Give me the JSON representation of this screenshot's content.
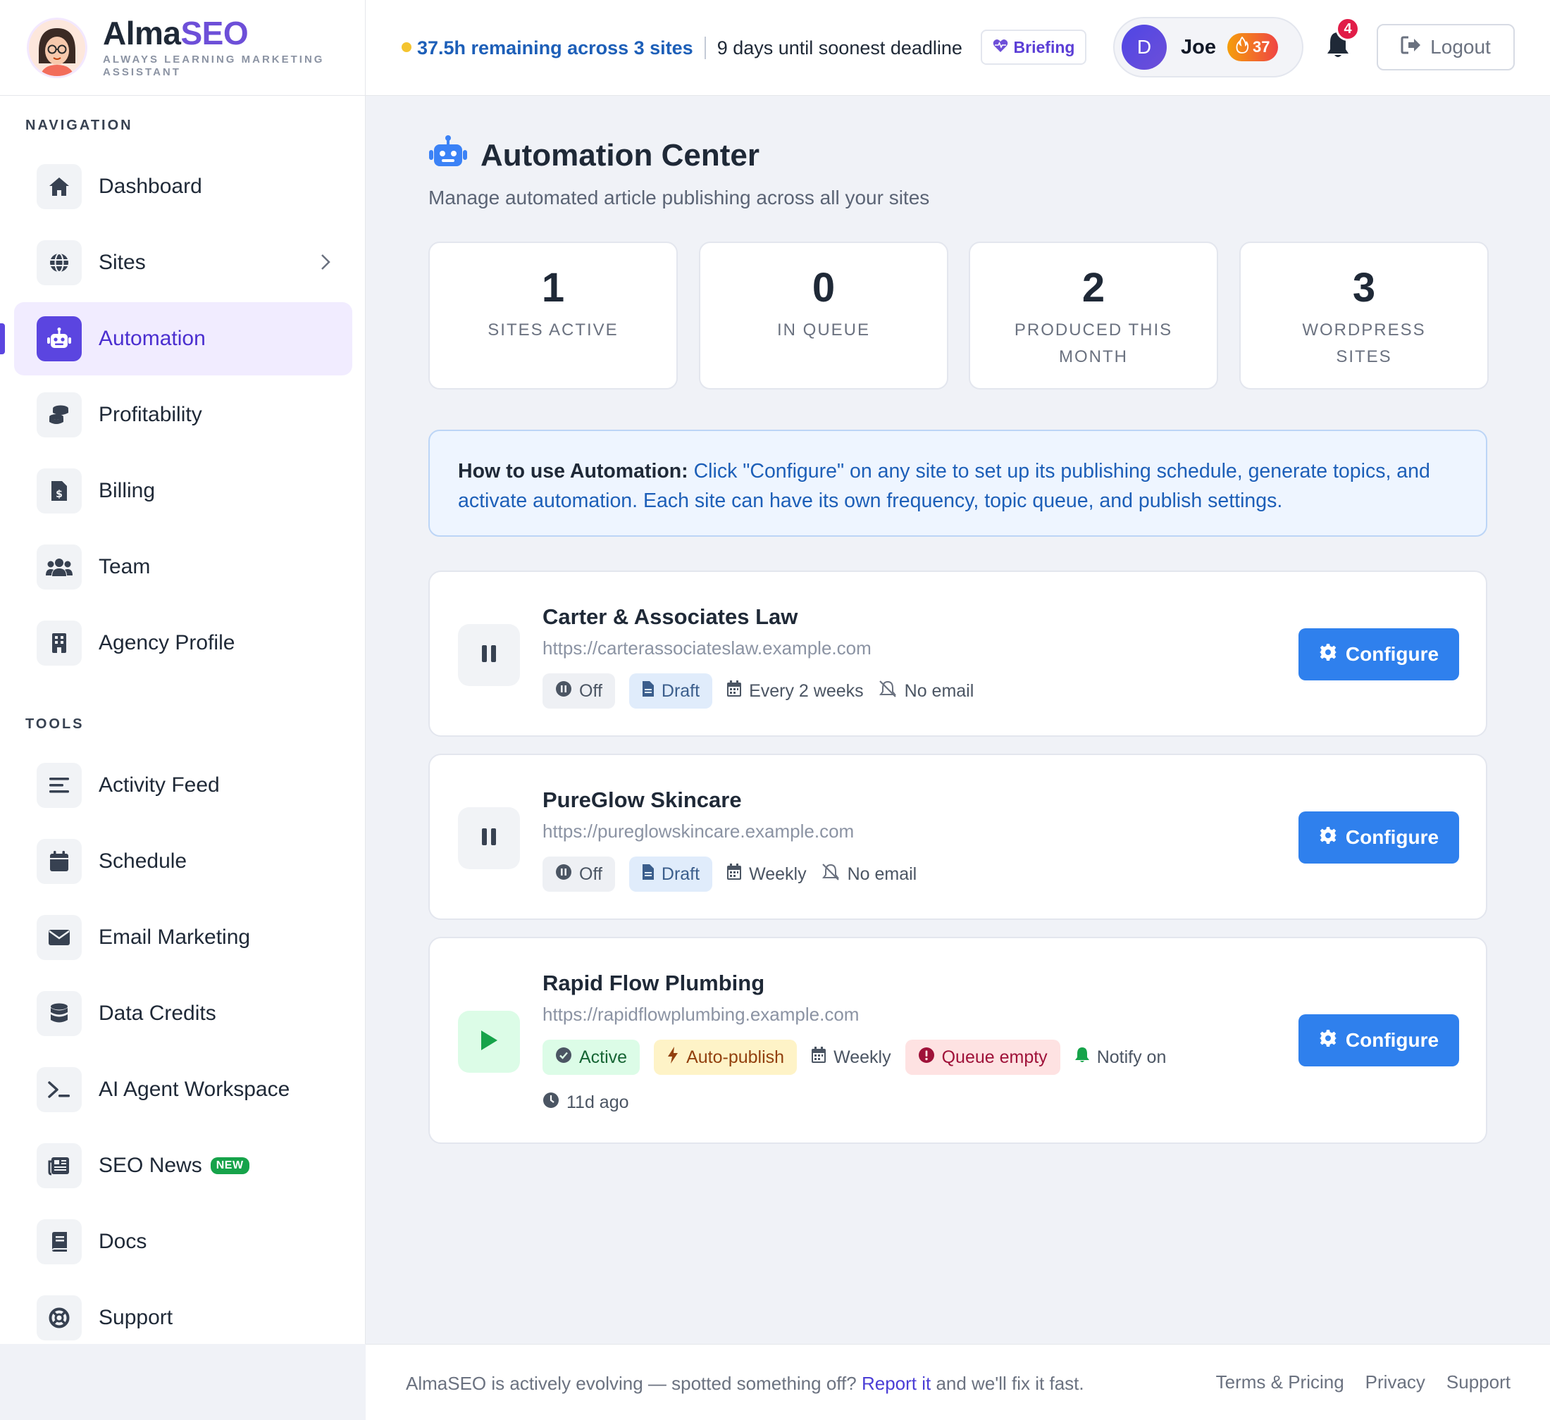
{
  "brand": {
    "name_part1": "Alma",
    "name_part2": "SEO",
    "tagline": "ALWAYS LEARNING MARKETING ASSISTANT"
  },
  "sidebar": {
    "nav_title": "NAVIGATION",
    "nav_items": [
      {
        "label": "Dashboard",
        "icon": "home-icon"
      },
      {
        "label": "Sites",
        "icon": "globe-icon"
      },
      {
        "label": "Automation",
        "icon": "robot-icon",
        "active": true
      },
      {
        "label": "Profitability",
        "icon": "coins-icon"
      },
      {
        "label": "Billing",
        "icon": "invoice-icon"
      },
      {
        "label": "Team",
        "icon": "users-icon"
      },
      {
        "label": "Agency Profile",
        "icon": "building-icon"
      }
    ],
    "tools_title": "TOOLS",
    "tool_items": [
      {
        "label": "Activity Feed",
        "icon": "list-icon"
      },
      {
        "label": "Schedule",
        "icon": "calendar-icon"
      },
      {
        "label": "Email Marketing",
        "icon": "envelope-icon"
      },
      {
        "label": "Data Credits",
        "icon": "database-icon"
      },
      {
        "label": "AI Agent Workspace",
        "icon": "terminal-icon"
      },
      {
        "label": "SEO News",
        "icon": "newspaper-icon",
        "badge": "NEW"
      },
      {
        "label": "Docs",
        "icon": "book-icon"
      },
      {
        "label": "Support",
        "icon": "lifebuoy-icon"
      }
    ]
  },
  "topbar": {
    "hours_remaining": "37.5h remaining across 3 sites",
    "deadline": "9 days until soonest deadline",
    "briefing_label": "Briefing",
    "user_initial": "D",
    "user_name": "Joe",
    "streak_count": "37",
    "notification_count": "4",
    "logout_label": "Logout"
  },
  "page": {
    "title": "Automation Center",
    "subtitle": "Manage automated article publishing across all your sites"
  },
  "stats": [
    {
      "value": "1",
      "label": "SITES ACTIVE"
    },
    {
      "value": "0",
      "label": "IN QUEUE"
    },
    {
      "value": "2",
      "label": "PRODUCED THIS MONTH"
    },
    {
      "value": "3",
      "label": "WORDPRESS SITES"
    }
  ],
  "info": {
    "lead": "How to use Automation:",
    "text": " Click \"Configure\" on any site to set up its publishing schedule, generate topics, and activate automation. Each site can have its own frequency, topic queue, and publish settings."
  },
  "sites": [
    {
      "name": "Carter & Associates Law",
      "url": "https://carterassociateslaw.example.com",
      "status": "Off",
      "mode": "Draft",
      "frequency": "Every 2 weeks",
      "email": "No email",
      "configure_label": "Configure"
    },
    {
      "name": "PureGlow Skincare",
      "url": "https://pureglowskincare.example.com",
      "status": "Off",
      "mode": "Draft",
      "frequency": "Weekly",
      "email": "No email",
      "configure_label": "Configure"
    },
    {
      "name": "Rapid Flow Plumbing",
      "url": "https://rapidflowplumbing.example.com",
      "status": "Active",
      "mode": "Auto-publish",
      "frequency": "Weekly",
      "queue": "Queue empty",
      "email": "Notify on",
      "last_run": "11d ago",
      "configure_label": "Configure"
    }
  ],
  "footer": {
    "note_before": "AlmaSEO is actively evolving — spotted something off? ",
    "report_link": "Report it",
    "note_after": " and we'll fix it fast.",
    "links": [
      "Terms & Pricing",
      "Privacy",
      "Support"
    ]
  },
  "colors": {
    "brand_purple": "#6d4fd8",
    "primary_blue": "#2f80ed",
    "active_nav_bg": "#f1ecff",
    "active_green": "#16a34a",
    "warning_red": "#e11d48"
  }
}
